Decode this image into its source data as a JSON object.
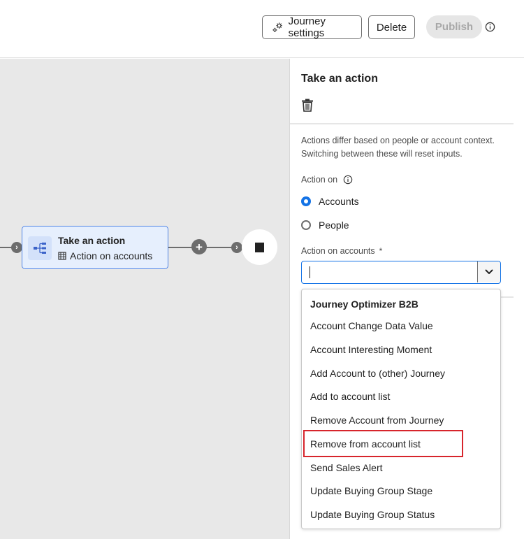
{
  "header": {
    "settings_button": "Journey settings",
    "delete_button": "Delete",
    "publish_button": "Publish",
    "icons": {
      "settings": "gear-icon",
      "info": "info-icon"
    }
  },
  "canvas": {
    "node": {
      "title": "Take an action",
      "subtitle": "Action on accounts",
      "icon": "action-tree-icon",
      "subtitle_icon": "building-icon"
    },
    "connector_icons": [
      "chevron-right-icon",
      "plus-icon",
      "chevron-right-icon"
    ],
    "end_node_icon": "stop-icon"
  },
  "panel": {
    "title": "Take an action",
    "delete_icon": "trash-icon",
    "description": "Actions differ based on people or account context. Switching between these will reset inputs.",
    "action_on_label": "Action on",
    "radio_options": [
      {
        "label": "Accounts",
        "selected": true
      },
      {
        "label": "People",
        "selected": false
      }
    ],
    "select_label": "Action on accounts",
    "required_mark": "*",
    "select_value": "",
    "dropdown": {
      "group_header": "Journey Optimizer B2B",
      "items": [
        "Account Change Data Value",
        "Account Interesting Moment",
        "Add Account to (other) Journey",
        "Add to account list",
        "Remove Account from Journey",
        "Remove from account list",
        "Send Sales Alert",
        "Update Buying Group Stage",
        "Update Buying Group Status"
      ],
      "highlighted_item": "Remove from account list"
    }
  },
  "colors": {
    "accent": "#1473e6",
    "node_bg": "#e6effd",
    "node_border": "#4f84e6",
    "canvas_bg": "#e8e8e8",
    "highlight": "#d7252c"
  }
}
